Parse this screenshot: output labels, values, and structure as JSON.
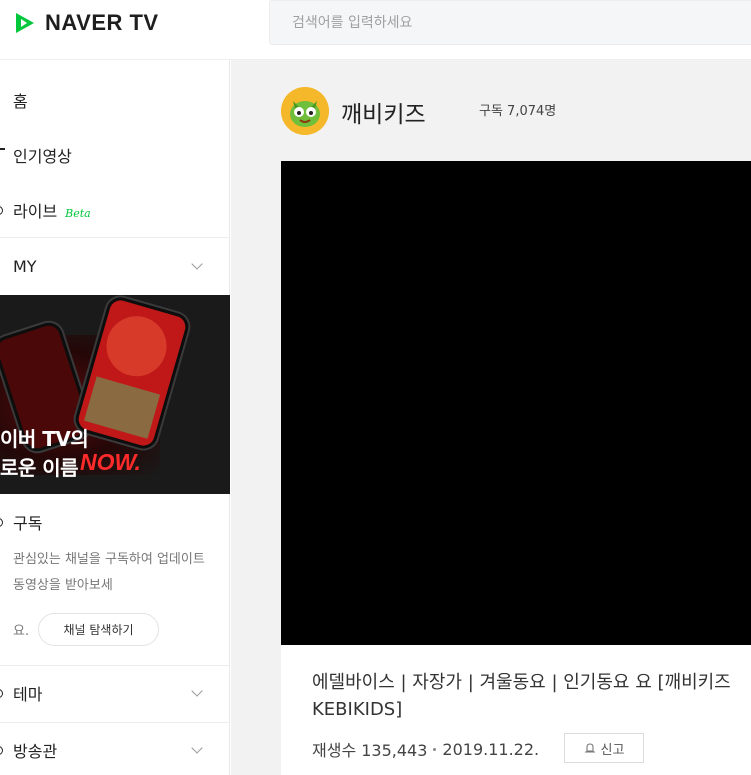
{
  "header": {
    "logo_text": "NAVER TV",
    "search_placeholder": "검색어를 입력하세요"
  },
  "sidebar": {
    "items": [
      {
        "label": "홈"
      },
      {
        "label": "인기영상"
      },
      {
        "label": "라이브",
        "badge": "Beta"
      },
      {
        "label": "MY"
      },
      {
        "label": "구독"
      },
      {
        "label": "테마"
      },
      {
        "label": "방송관"
      }
    ],
    "banner": {
      "line1": "이버 TV의",
      "line2": "로운 이름",
      "highlight": "NOW."
    },
    "subscribe": {
      "description": "관심있는 채널을 구독하여 업데이트 동영상을 받아보세",
      "description_end": "요.",
      "button": "채널 탐색하기"
    }
  },
  "channel": {
    "name": "깨비키즈",
    "subscribers": "구독 7,074명"
  },
  "video": {
    "title": "에델바이스 | 자장가 | 겨울동요 | 인기동요 요 [깨비키즈 KEBIKIDS]",
    "views": "재생수 135,443",
    "date": "2019.11.22.",
    "report_label": "신고"
  },
  "colors": {
    "brand_green": "#00c73c",
    "now_red": "#ff2a2a",
    "main_bg": "#f2f2f2"
  }
}
